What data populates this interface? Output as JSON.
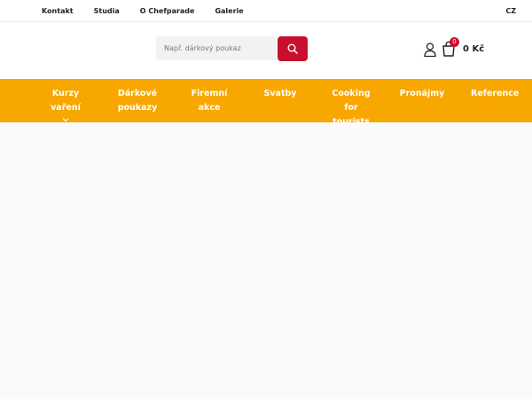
{
  "topbar": {
    "links": [
      "Kontakt",
      "Studia",
      "O Chefparade",
      "Galerie"
    ],
    "lang": "CZ"
  },
  "search": {
    "placeholder": "Např. dárkový poukaz",
    "icon": "search-icon"
  },
  "cart": {
    "count": "0",
    "total": "0 Kč"
  },
  "nav": {
    "items": [
      "Kurzy vaření",
      "Dárkové poukazy",
      "Firemní akce",
      "Svatby",
      "Cooking for tourists",
      "Pronájmy",
      "Reference"
    ]
  },
  "colors": {
    "accent": "#f8a700",
    "brand_red": "#c8102e"
  }
}
